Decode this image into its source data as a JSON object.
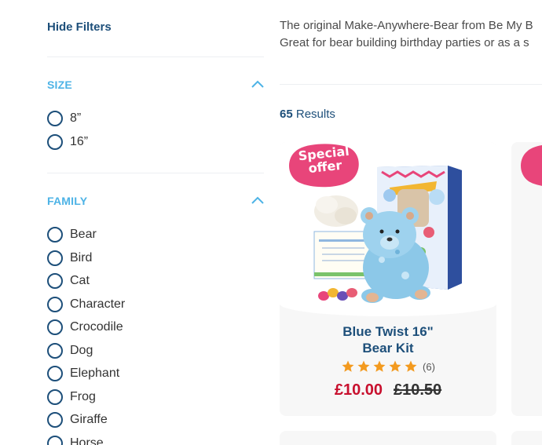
{
  "sidebar": {
    "hide_filters": "Hide Filters",
    "size": {
      "title": "SIZE",
      "options": [
        "8”",
        "16”"
      ]
    },
    "family": {
      "title": "FAMILY",
      "options": [
        "Bear",
        "Bird",
        "Cat",
        "Character",
        "Crocodile",
        "Dog",
        "Elephant",
        "Frog",
        "Giraffe",
        "Horse"
      ]
    }
  },
  "main": {
    "description_line1": "The original Make-Anywhere-Bear from Be My B",
    "description_line2": "Great for bear building birthday parties or as a s",
    "results_count": "65",
    "results_label": "Results"
  },
  "product": {
    "badge": "Special offer",
    "badge_line1": "Special",
    "badge_line2": "offer",
    "title_line1": "Blue Twist 16\"",
    "title_line2": "Bear Kit",
    "rating_stars": 5,
    "review_count": "(6)",
    "price_now": "£10.00",
    "price_was": "£10.50"
  },
  "colors": {
    "accent_blue": "#1d4f7a",
    "filter_title": "#4db3e6",
    "badge_pink": "#e8457a",
    "star_orange": "#f39a1f",
    "price_red": "#c8102e"
  }
}
